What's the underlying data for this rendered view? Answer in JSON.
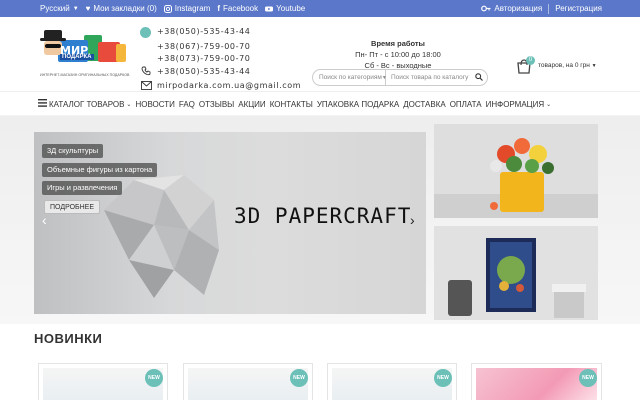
{
  "topbar": {
    "language": "Русский",
    "bookmarks": "Мои закладки (0)",
    "instagram": "Instagram",
    "facebook": "Facebook",
    "youtube": "Youtube",
    "login": "Авторизация",
    "register": "Регистрация"
  },
  "header": {
    "logo_text": "МИР",
    "logo_sub": "ПОДАРКА",
    "logo_tagline": "ИНТЕРНЕТ-МАГАЗИН ОРИГИНАЛЬНЫХ ПОДАРКОВ",
    "phones": [
      "+38(050)-535-43-44",
      "+38(067)-759-00-70",
      "+38(073)-759-00-70",
      "+38(050)-535-43-44"
    ],
    "email": "mirpodarka.com.ua@gmail.com",
    "hours_title": "Время работы",
    "hours_weekdays": "Пн- Пт - с 10:00 до 18:00",
    "hours_weekend": "Сб - Вс - выходные",
    "search_category_placeholder": "Поиск по категориям",
    "search_placeholder": "Поиск товара по каталогу",
    "cart_count": "0",
    "cart_text": "товаров, на 0 грн"
  },
  "nav": {
    "items": [
      "КАТАЛОГ ТОВАРОВ",
      "НОВОСТИ",
      "FAQ",
      "ОТЗЫВЫ",
      "АКЦИИ",
      "КОНТАКТЫ",
      "УПАКОВКА ПОДАРКА",
      "ДОСТАВКА",
      "ОПЛАТА",
      "ИНФОРМАЦИЯ"
    ]
  },
  "slider": {
    "title": "3D PAPERCRAFT",
    "categories": [
      "3Д скульптуры",
      "Объемные фигуры из картона",
      "Игры и развлечения"
    ],
    "more_button": "ПОДРОБНЕЕ"
  },
  "new_items": {
    "title": "НОВИНКИ",
    "badge": "NEW"
  },
  "colors": {
    "topbar": "#5a77c9",
    "accent": "#6cc0b8"
  }
}
